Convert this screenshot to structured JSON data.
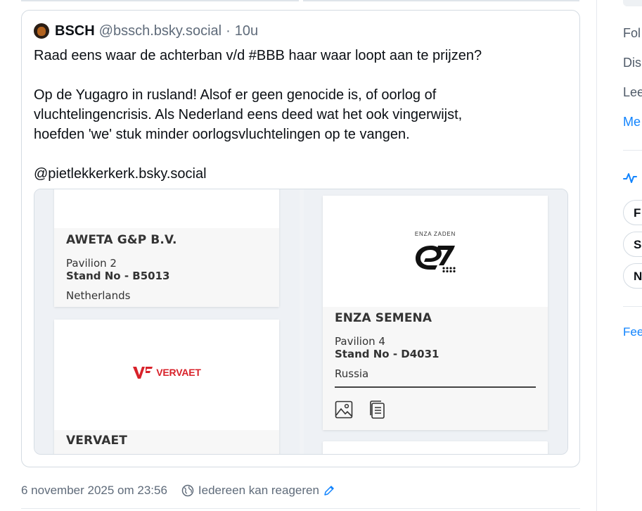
{
  "quote": {
    "display_name": "BSCH",
    "handle": "@bssch.bsky.social",
    "separator": "·",
    "age": "10u",
    "lines": [
      "Raad eens waar de achterban v/d #BBB haar waar loopt aan te prijzen?",
      "",
      "Op de Yugagro in rusland! Alsof er geen genocide is, of oorlog of",
      "vluchtelingencrisis.  Als Nederland eens deed wat het ook vingerwijst,",
      "hoefden 'we' stuk minder oorlogsvluchtelingen op te vangen.",
      "",
      "@pietlekkerkerk.bsky.social"
    ]
  },
  "media": {
    "left": {
      "card1": {
        "name": "AWETA G&P B.V.",
        "pavilion": "Pavilion 2",
        "stand": "Stand No - B5013",
        "country": "Netherlands"
      },
      "card2": {
        "logo_text": "VERVAET",
        "name": "VERVAET"
      }
    },
    "right": {
      "card1": {
        "logo_brand": "ENZA ZADEN",
        "name": "ENZA SEMENA",
        "pavilion": "Pavilion 4",
        "stand": "Stand No - D4031",
        "country": "Russia"
      }
    }
  },
  "footer": {
    "timestamp": "6 november 2025 om 23:56",
    "reply_setting": "Iedereen kan reageren"
  },
  "right_column": {
    "links": [
      "Fol",
      "Dis",
      "Lee"
    ],
    "more": "Me",
    "pills": [
      "F",
      "S",
      "N"
    ],
    "feed": "Fee"
  },
  "colors": {
    "link": "#1083fe",
    "muted": "#5f6b7a",
    "vervaet_red": "#d8222a"
  }
}
